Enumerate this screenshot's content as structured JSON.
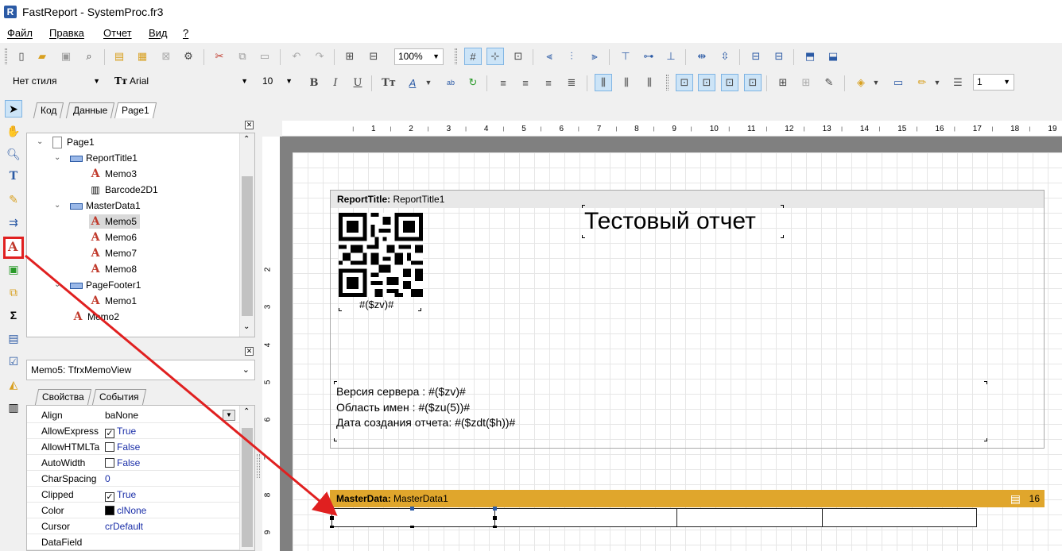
{
  "window": {
    "app_icon": "R",
    "title": "FastReport - SystemProc.fr3"
  },
  "menu": [
    "Файл",
    "Правка",
    "Отчет",
    "Вид",
    "?"
  ],
  "toolbar": {
    "zoom": "100%",
    "style": "Нет стиля",
    "font": "Arial",
    "font_size": "10",
    "bold": "B",
    "italic": "I",
    "underline": "U",
    "line_width": "1"
  },
  "tabs": [
    "Код",
    "Данные",
    "Page1"
  ],
  "tree": [
    {
      "label": "Page1",
      "icon": "page-icon"
    },
    {
      "label": "ReportTitle1",
      "icon": "band-icon"
    },
    {
      "label": "Memo3",
      "icon": "memo-icon"
    },
    {
      "label": "Barcode2D1",
      "icon": "barcode-icon"
    },
    {
      "label": "MasterData1",
      "icon": "band-icon"
    },
    {
      "label": "Memo5",
      "icon": "memo-icon",
      "selected": true
    },
    {
      "label": "Memo6",
      "icon": "memo-icon"
    },
    {
      "label": "Memo7",
      "icon": "memo-icon"
    },
    {
      "label": "Memo8",
      "icon": "memo-icon"
    },
    {
      "label": "PageFooter1",
      "icon": "band-icon"
    },
    {
      "label": "Memo1",
      "icon": "memo-icon"
    },
    {
      "label": "Memo2",
      "icon": "memo-icon"
    }
  ],
  "object_selector": "Memo5: TfrxMemoView",
  "inspector_tabs": [
    "Свойства",
    "События"
  ],
  "properties": [
    {
      "name": "Align",
      "value": "baNone",
      "kind": "plain"
    },
    {
      "name": "AllowExpress",
      "value": "True",
      "kind": "check-on"
    },
    {
      "name": "AllowHTMLTa",
      "value": "False",
      "kind": "check-off"
    },
    {
      "name": "AutoWidth",
      "value": "False",
      "kind": "check-off"
    },
    {
      "name": "CharSpacing",
      "value": "0",
      "kind": "plain"
    },
    {
      "name": "Clipped",
      "value": "True",
      "kind": "check-on"
    },
    {
      "name": "Color",
      "value": "clNone",
      "kind": "color"
    },
    {
      "name": "Cursor",
      "value": "crDefault",
      "kind": "plain"
    },
    {
      "name": "DataField",
      "value": "",
      "kind": "plain"
    }
  ],
  "ruler": {
    "h_marks": [
      "1",
      "2",
      "3",
      "4",
      "5",
      "6",
      "7",
      "8",
      "9",
      "10",
      "11",
      "12",
      "13",
      "14",
      "15",
      "16",
      "17",
      "18",
      "19"
    ],
    "v_marks": [
      "2",
      "3",
      "4",
      "5",
      "6",
      "7",
      "8",
      "9"
    ]
  },
  "report": {
    "report_title_label": "ReportTitle:",
    "report_title_name": "ReportTitle1",
    "heading": "Тестовый отчет",
    "qr_caption": "#($zv)#",
    "info_lines": [
      "Версия сервера : #($zv)#",
      "Область имен : #($zu(5))#",
      "Дата создания отчета: #($zdt($h))#"
    ],
    "master_label": "MasterData:",
    "master_name": "MasterData1",
    "master_count": "16"
  },
  "colors": {
    "master_band": "#e0a62c",
    "annotation": "#e02020",
    "selection": "#cce4f7"
  }
}
